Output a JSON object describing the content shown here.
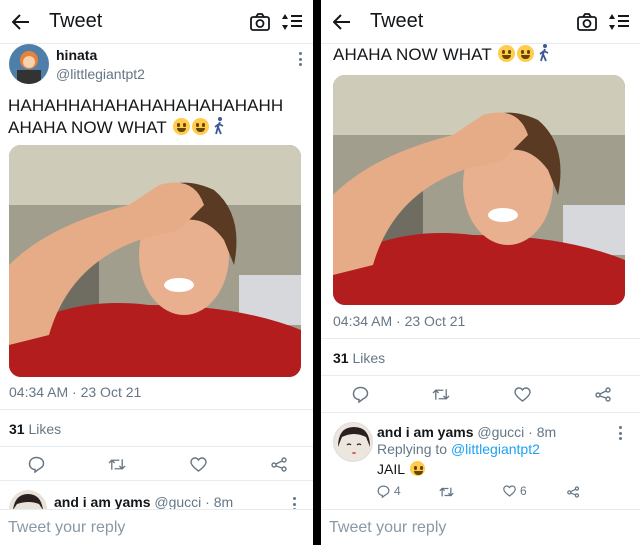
{
  "left": {
    "header": {
      "title": "Tweet"
    },
    "tweet": {
      "author_name": "hinata",
      "author_handle": "@littlegiantpt2",
      "text_line1": "HAHAHHAHAHAHAHAHAHAHAHH",
      "text_line2": "AHAHA NOW WHAT",
      "timestamp": "04:34 AM · 23 Oct 21",
      "likes_count": "31",
      "likes_label": "Likes"
    },
    "reply_peek": {
      "name": "and i am yams",
      "meta": "@gucci · 8m"
    },
    "reply_placeholder": "Tweet your reply"
  },
  "right": {
    "header": {
      "title": "Tweet"
    },
    "tweet": {
      "text_line2": "AHAHA NOW WHAT",
      "timestamp": "04:34 AM · 23 Oct 21",
      "likes_count": "31",
      "likes_label": "Likes"
    },
    "reply": {
      "name": "and i am yams",
      "meta": "@gucci · 8m",
      "replying_prefix": "Replying to",
      "replying_handle": "@littlegiantpt2",
      "text": "JAIL",
      "reply_count": "4",
      "like_count": "6"
    },
    "reply_placeholder": "Tweet your reply"
  },
  "colors": {
    "accent": "#1da1f2",
    "muted": "#657786",
    "border": "#e6ecf0",
    "shirt": "#b01c1c"
  },
  "icons": [
    "back-arrow-icon",
    "camera-icon",
    "sort-icon",
    "more-icon",
    "reply-icon",
    "retweet-icon",
    "like-icon",
    "share-icon",
    "laughing-emoji-icon",
    "walking-person-icon",
    "crying-emoji-icon"
  ]
}
